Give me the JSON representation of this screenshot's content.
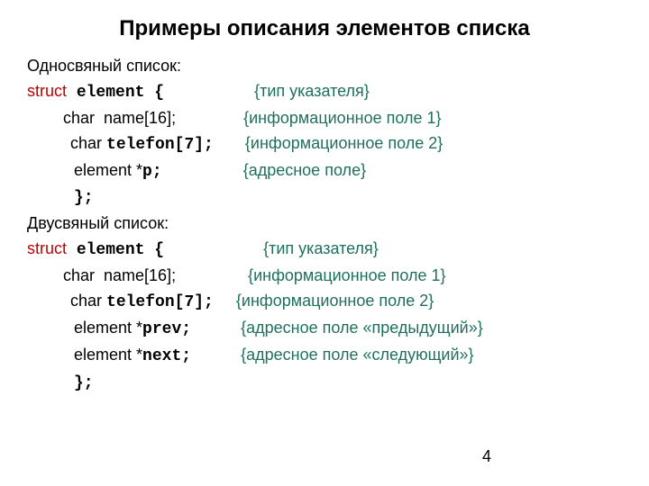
{
  "title": "Примеры описания элементов списка",
  "single": {
    "heading": "Односвяный список:",
    "struct_kw": "struct",
    "struct_decl": " element {",
    "struct_cmt": "{тип указателя}",
    "f1_code": "char  name[16];",
    "f1_cmt": "{информационное поле 1}",
    "f2_pre": "char ",
    "f2_mono": "telefon[7];",
    "f2_cmt": "{информационное поле 2}",
    "f3_pre": "element *",
    "f3_mono": "p;",
    "f3_cmt": "{адресное поле}",
    "close": "};"
  },
  "double": {
    "heading": "Двусвяный список:",
    "struct_kw": "struct",
    "struct_decl": " element {",
    "struct_cmt": "{тип указателя}",
    "f1_code": "char  name[16];",
    "f1_cmt": "{информационное поле 1}",
    "f2_pre": "char ",
    "f2_mono": "telefon[7];",
    "f2_cmt": "{информационное поле 2}",
    "f3_pre": "element *",
    "f3_mono": "prev;",
    "f3_cmt": "{адресное поле «предыдущий»}",
    "f4_pre": "element *",
    "f4_mono": "next;",
    "f4_cmt": "{адресное поле «следующий»}",
    "close": "};"
  },
  "page": "4"
}
